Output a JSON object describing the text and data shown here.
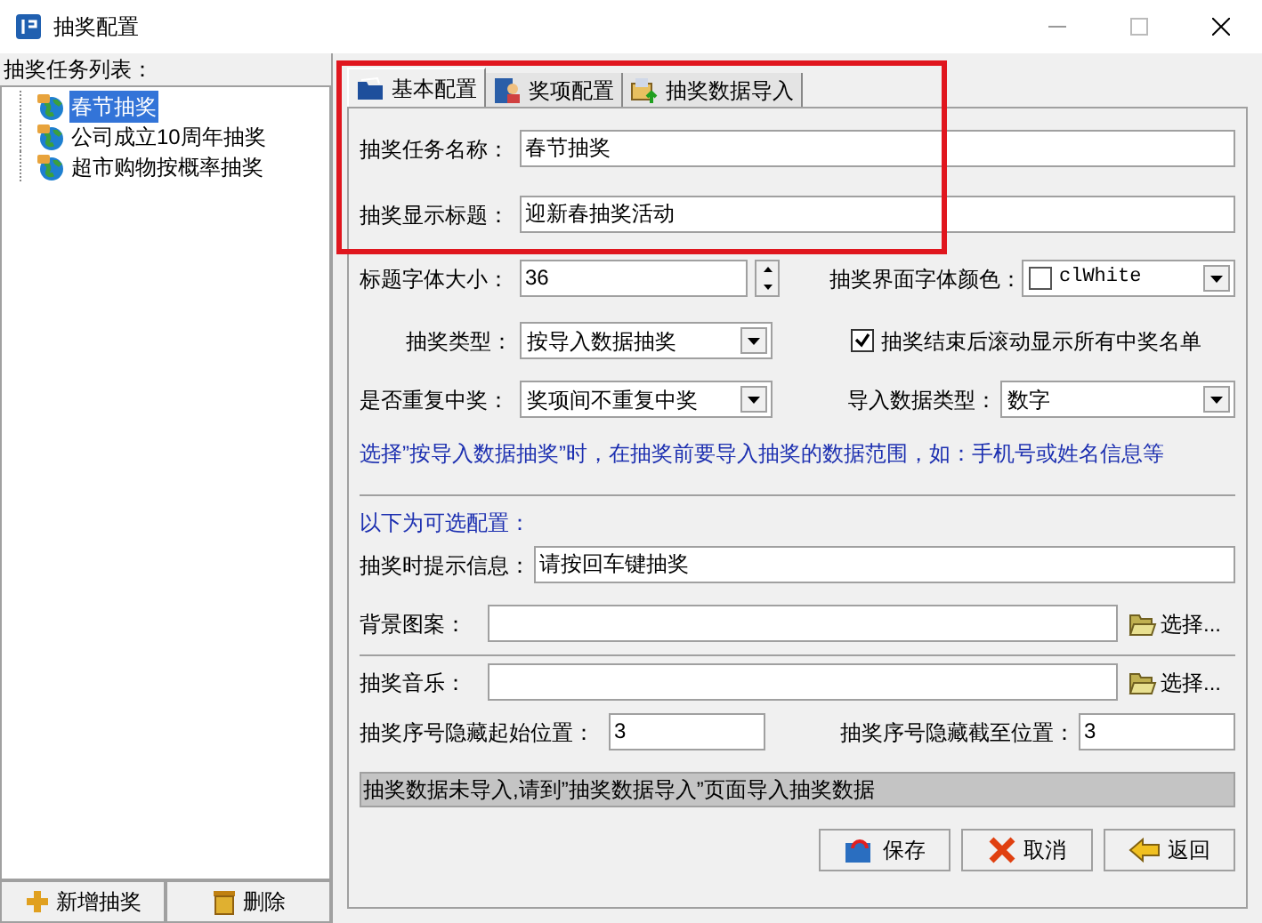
{
  "window": {
    "title": "抽奖配置"
  },
  "sidebar": {
    "label": "抽奖任务列表：",
    "tree": [
      {
        "label": "春节抽奖",
        "selected": true
      },
      {
        "label": "公司成立10周年抽奖",
        "selected": false
      },
      {
        "label": "超市购物按概率抽奖",
        "selected": false
      }
    ],
    "buttons": [
      {
        "kind": "add",
        "label": "新增抽奖"
      },
      {
        "kind": "delete",
        "label": "删除"
      }
    ]
  },
  "tabs": [
    {
      "kind": "folder",
      "label": "基本配置",
      "selected": true
    },
    {
      "kind": "person",
      "label": "奖项配置",
      "selected": false
    },
    {
      "kind": "import",
      "label": "抽奖数据导入",
      "selected": false
    }
  ],
  "basic": {
    "task_name": {
      "label": "抽奖任务名称：",
      "value": "春节抽奖"
    },
    "display_title": {
      "label": "抽奖显示标题：",
      "value": "迎新春抽奖活动"
    }
  },
  "font_size": {
    "label": "标题字体大小：",
    "value": "36"
  },
  "font_color": {
    "label": "抽奖界面字体颜色：",
    "value": "clWhite",
    "color": "#ffffff"
  },
  "draw_type": {
    "label": "抽奖类型：",
    "value": "按导入数据抽奖"
  },
  "scroll_winners": {
    "label": "抽奖结束后滚动显示所有中奖名单",
    "checked": true
  },
  "repeat": {
    "label": "是否重复中奖：",
    "value": "奖项间不重复中奖"
  },
  "import_type": {
    "label": "导入数据类型：",
    "value": "数字"
  },
  "hint": "选择”按导入数据抽奖”时，在抽奖前要导入抽奖的数据范围，如：手机号或姓名信息等",
  "optional_heading": "以下为可选配置：",
  "prompt": {
    "label": "抽奖时提示信息：",
    "value": "请按回车键抽奖"
  },
  "background": {
    "label": "背景图案：",
    "button": "选择..."
  },
  "music": {
    "label": "抽奖音乐：",
    "button": "选择..."
  },
  "hide_start": {
    "label": "抽奖序号隐藏起始位置：",
    "value": "3"
  },
  "hide_end": {
    "label": "抽奖序号隐藏截至位置：",
    "value": "3"
  },
  "status": "抽奖数据未导入,请到”抽奖数据导入”页面导入抽奖数据",
  "actions": [
    {
      "kind": "save",
      "label": "保存"
    },
    {
      "kind": "cancel",
      "label": "取消"
    },
    {
      "kind": "back",
      "label": "返回"
    }
  ]
}
